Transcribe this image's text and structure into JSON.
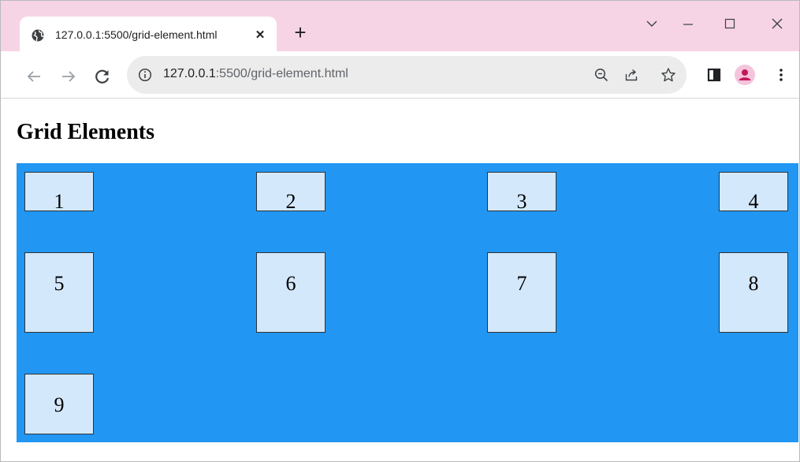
{
  "browser": {
    "tab": {
      "title": "127.0.0.1:5500/grid-element.html",
      "close_symbol": "✕",
      "favicon": "globe-icon"
    },
    "new_tab_symbol": "+",
    "address_bar": {
      "url_host": "127.0.0.1",
      "url_rest": ":5500/grid-element.html"
    },
    "colors": {
      "titlebar": "#f6d4e5",
      "tab": "#ffffff",
      "omnibox": "#ececec",
      "avatar_bg": "#f4c4dc",
      "avatar_fg": "#c2185b"
    }
  },
  "page": {
    "heading": "Grid Elements",
    "grid": {
      "background": "#2196f3",
      "item_background": "#d3e8fb",
      "items": [
        "1",
        "2",
        "3",
        "4",
        "5",
        "6",
        "7",
        "8",
        "9"
      ]
    }
  }
}
